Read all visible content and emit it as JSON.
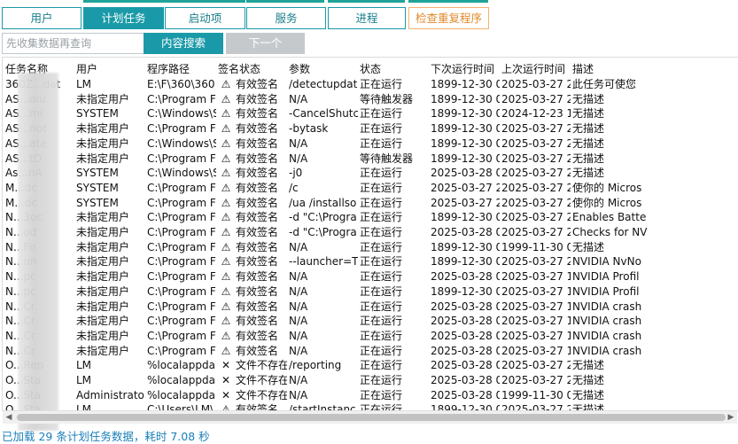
{
  "tabs": [
    {
      "label": "用户",
      "active": false
    },
    {
      "label": "计划任务",
      "active": true
    },
    {
      "label": "启动项",
      "active": false
    },
    {
      "label": "服务",
      "active": false
    },
    {
      "label": "进程",
      "active": false
    },
    {
      "label": "检查重复程序",
      "active": false
    }
  ],
  "search": {
    "placeholder": "先收集数据再查询",
    "button_search": "内容搜索",
    "button_next": "下一个"
  },
  "columns": [
    "任务名称",
    "用户",
    "程序路径",
    "签名状态",
    "参数",
    "状态",
    "下次运行时间",
    "上次运行时间",
    "描述"
  ],
  "rows": [
    [
      "360Z...dat",
      "LM",
      "E:\\F\\360\\360",
      "⚠",
      "有效签名",
      "/detectupdat",
      "正在运行",
      "1899-12-30 0",
      "2025-03-27 2",
      "此任务可使您"
    ],
    [
      "AS...olu",
      "未指定用户",
      "C:\\Program F",
      "⚠",
      "有效签名",
      "N/A",
      "等待触发器",
      "1899-12-30 0",
      "2025-03-27 2",
      "无描述"
    ],
    [
      "AS...mi",
      "SYSTEM",
      "C:\\Windows\\S",
      "⚠",
      "有效签名",
      "-CancelShutc",
      "正在运行",
      "1899-12-30 0",
      "2024-12-23 1",
      "无描述"
    ],
    [
      "AS...not",
      "未指定用户",
      "C:\\Program F",
      "⚠",
      "有效签名",
      "-bytask",
      "正在运行",
      "1899-12-30 0",
      "2025-03-27 2",
      "无描述"
    ],
    [
      "AS...ate",
      "未指定用户",
      "C:\\Windows\\S",
      "⚠",
      "有效签名",
      "N/A",
      "正在运行",
      "1899-12-30 0",
      "2025-03-27 2",
      "无描述"
    ],
    [
      "AS...tD",
      "未指定用户",
      "C:\\Program F",
      "⚠",
      "有效签名",
      "N/A",
      "等待触发器",
      "1899-12-30 0",
      "2025-03-27 2",
      "无描述"
    ],
    [
      "As...nA",
      "SYSTEM",
      "C:\\Windows\\S",
      "⚠",
      "有效签名",
      "-j0",
      "正在运行",
      "2025-03-28 0",
      "2025-03-27 2",
      "无描述"
    ],
    [
      "M...dc",
      "SYSTEM",
      "C:\\Program F",
      "⚠",
      "有效签名",
      "/c",
      "正在运行",
      "2025-03-27 2",
      "2025-03-27 2",
      "使你的 Micros"
    ],
    [
      "M...dc",
      "SYSTEM",
      "C:\\Program F",
      "⚠",
      "有效签名",
      "/ua /installso",
      "正在运行",
      "2025-03-27 2",
      "2025-03-27 2",
      "使你的 Micros"
    ],
    [
      "N...3oc",
      "未指定用户",
      "C:\\Program F",
      "⚠",
      "有效签名",
      "-d \"C:\\Progra",
      "正在运行",
      "1899-12-30 0",
      "2025-03-27 2",
      "Enables Batte"
    ],
    [
      "N...od",
      "未指定用户",
      "C:\\Program F",
      "⚠",
      "有效签名",
      "-d \"C:\\Progra",
      "正在运行",
      "2025-03-28 0",
      "2025-03-27 2",
      "Checks for NV"
    ],
    [
      "N...Fo",
      "未指定用户",
      "C:\\Program F",
      "⚠",
      "有效签名",
      "N/A",
      "正在运行",
      "1899-12-30 0",
      "1999-11-30 0",
      "无描述"
    ],
    [
      "N...un",
      "未指定用户",
      "C:\\Program F",
      "⚠",
      "有效签名",
      "--launcher=T",
      "正在运行",
      "1899-12-30 0",
      "2025-03-27 2",
      "NVIDIA NvNo"
    ],
    [
      "N...pc",
      "未指定用户",
      "C:\\Program F",
      "⚠",
      "有效签名",
      "N/A",
      "正在运行",
      "2025-03-28 0",
      "2025-03-27 1",
      "NVIDIA Profil"
    ],
    [
      "N...pc",
      "未指定用户",
      "C:\\Program F",
      "⚠",
      "有效签名",
      "N/A",
      "正在运行",
      "1899-12-30 0",
      "2025-03-27 1",
      "NVIDIA Profil"
    ],
    [
      "N...Cr",
      "未指定用户",
      "C:\\Program F",
      "⚠",
      "有效签名",
      "N/A",
      "正在运行",
      "2025-03-28 0",
      "2025-03-27 1",
      "NVIDIA crash"
    ],
    [
      "N...Cr",
      "未指定用户",
      "C:\\Program F",
      "⚠",
      "有效签名",
      "N/A",
      "正在运行",
      "2025-03-28 0",
      "2025-03-27 1",
      "NVIDIA crash"
    ],
    [
      "N...Cr",
      "未指定用户",
      "C:\\Program F",
      "⚠",
      "有效签名",
      "N/A",
      "正在运行",
      "2025-03-28 0",
      "2025-03-27 1",
      "NVIDIA crash"
    ],
    [
      "N...Cr",
      "未指定用户",
      "C:\\Program F",
      "⚠",
      "有效签名",
      "N/A",
      "正在运行",
      "2025-03-28 0",
      "2025-03-27 1",
      "NVIDIA crash"
    ],
    [
      "O...Rep",
      "LM",
      "%localappda",
      "✕",
      "文件不存在",
      "/reporting",
      "正在运行",
      "2025-03-28 0",
      "2025-03-27 2",
      "无描述"
    ],
    [
      "O...Sta",
      "LM",
      "%localappda",
      "✕",
      "文件不存在",
      "N/A",
      "正在运行",
      "2025-03-28 0",
      "2025-03-27 2",
      "无描述"
    ],
    [
      "O...Sta",
      "Administrato",
      "%localappda",
      "✕",
      "文件不存在",
      "N/A",
      "正在运行",
      "2025-03-28 0",
      "1999-11-30 0",
      "无描述"
    ],
    [
      "O...Sta",
      "LM",
      "C:\\Users\\LM\\",
      "⚠",
      "有效签名",
      "/startInstanc",
      "正在运行",
      "1899-12-30 0",
      "2025-03-27 2",
      "无描述"
    ]
  ],
  "status_text": "已加载 29 条计划任务数据，耗时 7.08 秒",
  "colors": {
    "accent": "#1a9aa8",
    "warn_border": "#f2b370",
    "status": "#1b7fb8"
  }
}
